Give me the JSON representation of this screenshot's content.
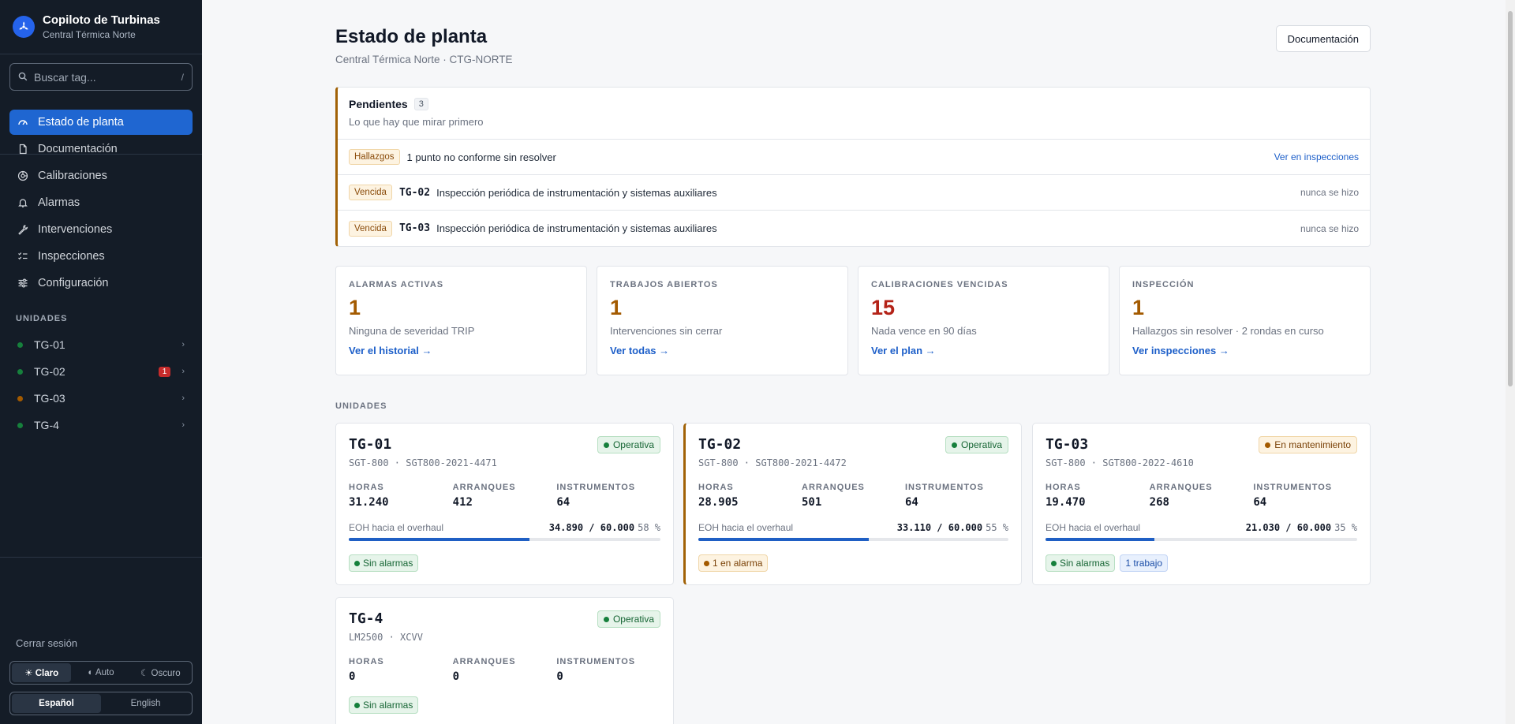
{
  "brand": {
    "title": "Copiloto de Turbinas",
    "subtitle": "Central Térmica Norte"
  },
  "search": {
    "placeholder": "Buscar tag...",
    "shortcut": "/"
  },
  "nav": [
    {
      "label": "Estado de planta",
      "icon": "gauge-icon",
      "active": true
    },
    {
      "label": "Documentación",
      "icon": "document-icon"
    },
    {
      "label": "Calibraciones",
      "icon": "target-icon"
    },
    {
      "label": "Alarmas",
      "icon": "bell-icon"
    },
    {
      "label": "Intervenciones",
      "icon": "wrench-icon"
    },
    {
      "label": "Inspecciones",
      "icon": "checklist-icon"
    },
    {
      "label": "Configuración",
      "icon": "sliders-icon"
    }
  ],
  "units_section": "UNIDADES",
  "sidebar_units": [
    {
      "name": "TG-01",
      "dot": "#16803c",
      "badge": ""
    },
    {
      "name": "TG-02",
      "dot": "#16803c",
      "badge": "1"
    },
    {
      "name": "TG-03",
      "dot": "#a35a00",
      "badge": ""
    },
    {
      "name": "TG-4",
      "dot": "#16803c",
      "badge": ""
    }
  ],
  "logout": "Cerrar sesión",
  "theme": {
    "light": "☀ Claro",
    "auto": "◐ Auto",
    "dark": "☾ Oscuro",
    "selected": "light"
  },
  "lang": {
    "es": "Español",
    "en": "English",
    "selected": "es"
  },
  "header": {
    "title": "Estado de planta",
    "subtitle": "Central Térmica Norte · CTG-NORTE",
    "doc_button": "Documentación"
  },
  "pending": {
    "title": "Pendientes",
    "count": "3",
    "desc": "Lo que hay que mirar primero",
    "rows": [
      {
        "tag": "Hallazgos",
        "unit": "",
        "text": "1 punto no conforme sin resolver",
        "right": "Ver en inspecciones",
        "right_is_link": true
      },
      {
        "tag": "Vencida",
        "unit": "TG-02",
        "text": "Inspección periódica de instrumentación y sistemas auxiliares",
        "right": "nunca se hizo",
        "right_is_link": false
      },
      {
        "tag": "Vencida",
        "unit": "TG-03",
        "text": "Inspección periódica de instrumentación y sistemas auxiliares",
        "right": "nunca se hizo",
        "right_is_link": false
      }
    ]
  },
  "kpis": [
    {
      "label": "ALARMAS ACTIVAS",
      "value": "1",
      "desc": "Ninguna de severidad TRIP",
      "link": "Ver el historial →",
      "red": false
    },
    {
      "label": "TRABAJOS ABIERTOS",
      "value": "1",
      "desc": "Intervenciones sin cerrar",
      "link": "Ver todas →",
      "red": false
    },
    {
      "label": "CALIBRACIONES VENCIDAS",
      "value": "15",
      "desc": "Nada vence en 90 días",
      "link": "Ver el plan →",
      "red": true
    },
    {
      "label": "INSPECCIÓN",
      "value": "1",
      "desc": "Hallazgos sin resolver · 2 rondas en curso",
      "link": "Ver inspecciones →",
      "red": false
    }
  ],
  "units_heading": "UNIDADES",
  "stat_labels": {
    "hours": "HORAS",
    "starts": "ARRANQUES",
    "instruments": "INSTRUMENTOS"
  },
  "eoh_label": "EOH hacia el overhaul",
  "units": [
    {
      "name": "TG-01",
      "model": "SGT-800 · SGT800-2021-4471",
      "status": "Operativa",
      "status_kind": "ok",
      "hours": "31.240",
      "starts": "412",
      "instruments": "64",
      "eoh": "34.890 / 60.000",
      "eoh_pct": "58 %",
      "eoh_fraction": 0.58,
      "chips": [
        {
          "kind": "green",
          "label": "Sin alarmas",
          "dot": true
        }
      ],
      "alert": false
    },
    {
      "name": "TG-02",
      "model": "SGT-800 · SGT800-2021-4472",
      "status": "Operativa",
      "status_kind": "ok",
      "hours": "28.905",
      "starts": "501",
      "instruments": "64",
      "eoh": "33.110 / 60.000",
      "eoh_pct": "55 %",
      "eoh_fraction": 0.55,
      "chips": [
        {
          "kind": "amber",
          "label": "1 en alarma",
          "dot": true
        }
      ],
      "alert": true
    },
    {
      "name": "TG-03",
      "model": "SGT-800 · SGT800-2022-4610",
      "status": "En mantenimiento",
      "status_kind": "maint",
      "hours": "19.470",
      "starts": "268",
      "instruments": "64",
      "eoh": "21.030 / 60.000",
      "eoh_pct": "35 %",
      "eoh_fraction": 0.35,
      "chips": [
        {
          "kind": "green",
          "label": "Sin alarmas",
          "dot": true
        },
        {
          "kind": "blue",
          "label": "1 trabajo",
          "dot": false
        }
      ],
      "alert": false
    },
    {
      "name": "TG-4",
      "model": "LM2500 · XCVV",
      "status": "Operativa",
      "status_kind": "ok",
      "hours": "0",
      "starts": "0",
      "instruments": "0",
      "eoh": "",
      "eoh_pct": "",
      "eoh_fraction": null,
      "chips": [
        {
          "kind": "green",
          "label": "Sin alarmas",
          "dot": true
        }
      ],
      "alert": false
    }
  ]
}
